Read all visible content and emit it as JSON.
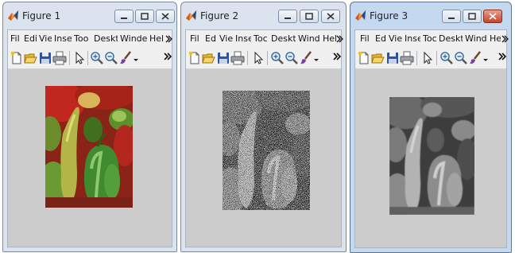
{
  "windows": [
    {
      "title": "Figure 1",
      "menu": [
        "Fil",
        "Edi",
        "Vie",
        "Inse",
        "Too",
        "Deskt",
        "Winde",
        "Hel"
      ],
      "image_kind": "color",
      "close_highlighted": false
    },
    {
      "title": "Figure 2",
      "menu": [
        "Fil",
        "Ed",
        "Vie",
        "Inse",
        "Toc",
        "Deskt",
        "Wind",
        "Hel"
      ],
      "image_kind": "noisy-gray",
      "close_highlighted": false
    },
    {
      "title": "Figure 3",
      "menu": [
        "Fil",
        "Ed",
        "Vie",
        "Inse",
        "Toc",
        "Deskt",
        "Wind",
        "He"
      ],
      "image_kind": "smooth-gray",
      "close_highlighted": true
    }
  ],
  "icons": {
    "app": "matlab-icon",
    "minimize": "minimize-icon",
    "maximize": "maximize-icon",
    "close": "close-icon",
    "menu_overflow": "menu-overflow-icon",
    "toolbar": [
      "new-figure-icon",
      "open-file-icon",
      "save-icon",
      "print-icon",
      "pointer-icon",
      "zoom-in-icon",
      "zoom-out-icon",
      "data-brush-icon"
    ],
    "toolbar_overflow": "toolbar-overflow-icon"
  },
  "colors": {
    "canvas_gray": "#cccccc",
    "active_titlebar": "#c4d9ef",
    "inactive_titlebar": "#dbe4ee",
    "close_red": "#c0452d"
  }
}
